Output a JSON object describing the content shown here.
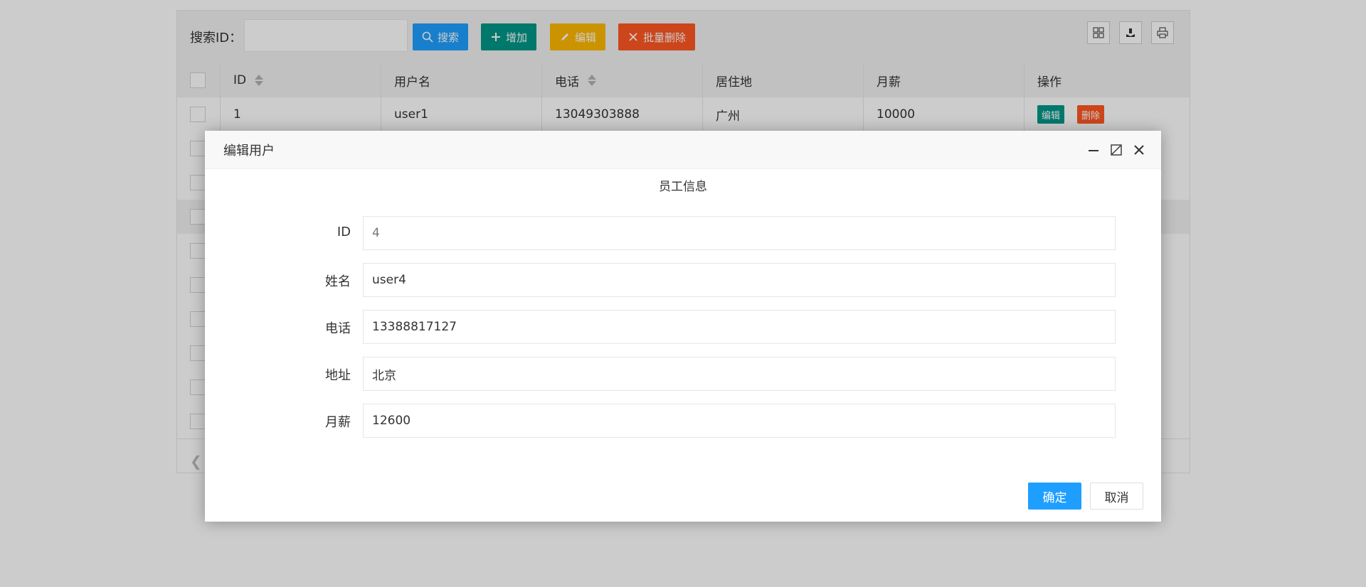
{
  "toolbar": {
    "search_label": "搜索ID：",
    "search_value": "",
    "search_button": "搜索",
    "add_button": "增加",
    "edit_button": "编辑",
    "batch_delete_button": "批量删除",
    "right_icons": [
      "columns-icon",
      "export-icon",
      "print-icon"
    ]
  },
  "table": {
    "headers": [
      "ID",
      "用户名",
      "电话",
      "居住地",
      "月薪",
      "操作"
    ],
    "sortable": [
      "ID",
      "电话"
    ],
    "rows": [
      {
        "id": "1",
        "username": "user1",
        "phone": "13049303888",
        "city": "广州",
        "salary": "10000"
      }
    ],
    "row_actions": {
      "edit": "编辑",
      "delete": "删除"
    }
  },
  "dialog": {
    "title": "编辑用户",
    "section_title": "员工信息",
    "fields": [
      {
        "label": "ID",
        "value": "4"
      },
      {
        "label": "姓名",
        "value": "user4"
      },
      {
        "label": "电话",
        "value": "13388817127"
      },
      {
        "label": "地址",
        "value": "北京"
      },
      {
        "label": "月薪",
        "value": "12600"
      }
    ],
    "confirm_button": "确定",
    "cancel_button": "取消"
  },
  "colors": {
    "blue": "#1e9fff",
    "green": "#009688",
    "yellow": "#ffb800",
    "orange": "#ff5722"
  }
}
